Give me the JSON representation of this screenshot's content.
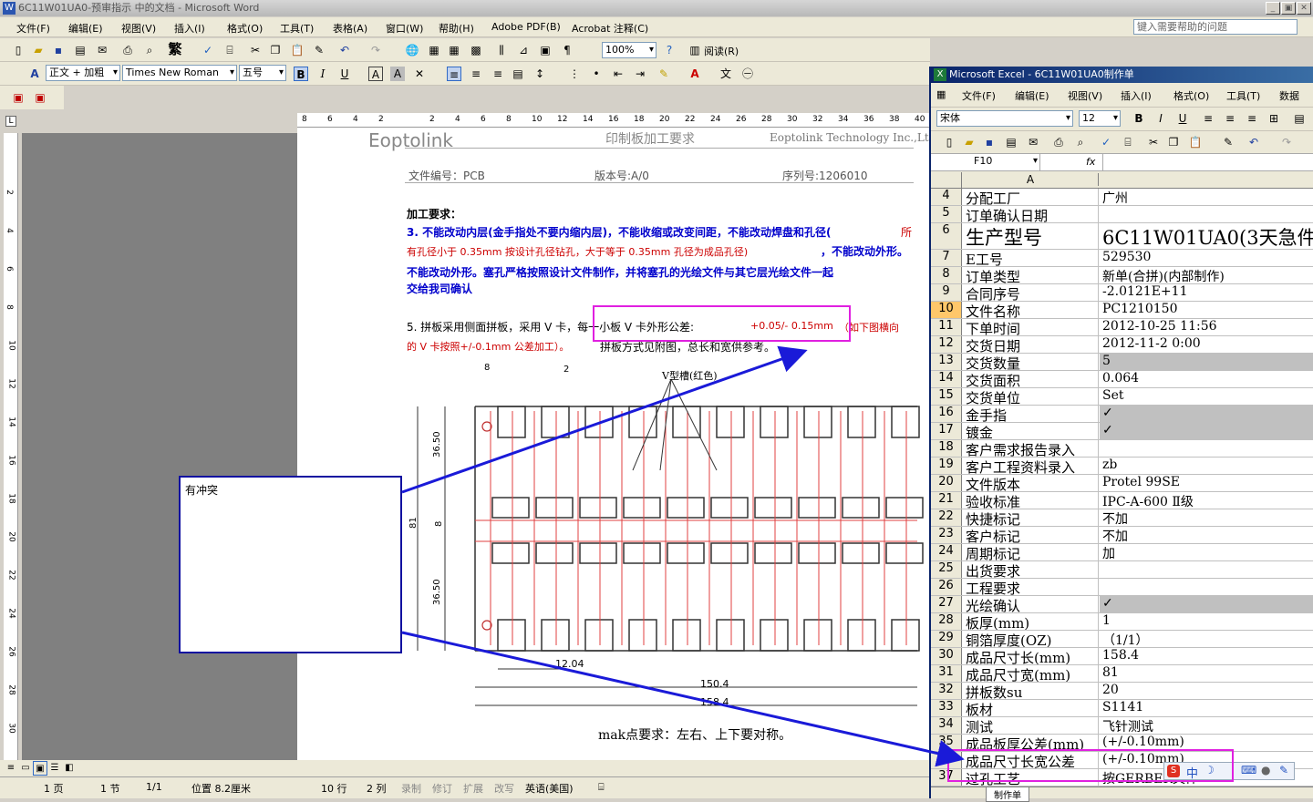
{
  "word": {
    "title": "6C11W01UA0-预审指示 中的文档 - Microsoft Word",
    "menu": [
      "文件(F)",
      "编辑(E)",
      "视图(V)",
      "插入(I)",
      "格式(O)",
      "工具(T)",
      "表格(A)",
      "窗口(W)",
      "帮助(H)",
      "Adobe PDF(B)",
      "Acrobat 注释(C)"
    ],
    "help_placeholder": "键入需要帮助的问题",
    "zoom": "100%",
    "read_label": "阅读(R)",
    "fan_label": "繁",
    "style": "正文 + 加粗",
    "font": "Times New Roman",
    "size": "五号",
    "ruler_ticks": [
      "8",
      "6",
      "4",
      "2",
      "",
      "2",
      "4",
      "6",
      "8",
      "10",
      "12",
      "14",
      "16",
      "18",
      "20",
      "22",
      "24",
      "26",
      "28",
      "30",
      "32",
      "34",
      "36",
      "38",
      "40"
    ],
    "vruler_ticks": [
      "2",
      "4",
      "6",
      "8",
      "10",
      "12",
      "14",
      "16",
      "18",
      "20",
      "22",
      "24",
      "26",
      "28",
      "30"
    ],
    "doc": {
      "logo": "Eoptolink",
      "heading": "印制板加工要求",
      "company": "Eoptolink Technology Inc.,Ltd",
      "file_no": "文件编号：PCB",
      "version": "版本号:A/0",
      "serial": "序列号:1206010",
      "req_title": "加工要求：",
      "req3_line1": "3. 不能改动内层(金手指处不要内缩内层)，不能收缩或改变间距，不能改动焊盘和孔径(",
      "req3_red1": "所",
      "req3_line2_red": "有孔径小于 0.35mm 按设计孔径钻孔，大于等于 0.35mm 孔径为成品孔径)",
      "req3_line2_blue": "，不能改动外形。",
      "req3_line3": "不能改动外形。塞孔严格按照设计文件制作，并将塞孔的光绘文件与其它层光绘文件一起",
      "req3_line4": "交给我司确认",
      "req5_a": "5. 拼板采用侧面拼板，采用 V 卡，每一小板 V 卡外形公差:",
      "req5_tol": "+0.05/- 0.15mm",
      "req5_b": "（如下图横向",
      "req5_c": "的 V 卡按照+/-0.1mm 公差加工）。",
      "req5_d": "拼板方式见附图，总长和宽供参考。",
      "dim_8": "8",
      "dim_2": "2",
      "v_slot": "V型槽(红色)",
      "dim_3650a": "36.50",
      "dim_8b": "8",
      "dim_81": "81",
      "dim_3650b": "36.50",
      "dim_1204": "12.04",
      "dim_1504": "150.4",
      "dim_1584": "158.4",
      "mark_note": "mak点要求：左右、上下要对称。"
    },
    "status": {
      "page": "1 页",
      "section": "1 节",
      "pages": "1/1",
      "pos": "位置 8.2厘米",
      "line": "10 行",
      "col": "2 列",
      "rec": "录制",
      "trk": "修订",
      "ext": "扩展",
      "ovr": "改写",
      "lang": "英语(美国)"
    }
  },
  "excel": {
    "title": "Microsoft Excel - 6C11W01UA0制作单",
    "menu": [
      "文件(F)",
      "编辑(E)",
      "视图(V)",
      "插入(I)",
      "格式(O)",
      "工具(T)",
      "数据"
    ],
    "font": "宋体",
    "size": "12",
    "cell_ref": "F10",
    "fx": "fx",
    "col_a": "A",
    "sheet_tab": "制作单",
    "rows": [
      {
        "n": "4",
        "a": "分配工厂",
        "b": "广州"
      },
      {
        "n": "5",
        "a": "订单确认日期",
        "b": ""
      },
      {
        "n": "6",
        "a": "生产型号",
        "b": "6C11W01UA0(3天急件)"
      },
      {
        "n": "7",
        "a": "E工号",
        "b": "529530"
      },
      {
        "n": "8",
        "a": "订单类型",
        "b": "新单(合拼)(内部制作)"
      },
      {
        "n": "9",
        "a": "合同序号",
        "b": "-2.0121E+11"
      },
      {
        "n": "10",
        "a": "文件名称",
        "b": "PC1210150"
      },
      {
        "n": "11",
        "a": "下单时间",
        "b": "2012-10-25 11:56"
      },
      {
        "n": "12",
        "a": "交货日期",
        "b": "2012-11-2 0:00"
      },
      {
        "n": "13",
        "a": "交货数量",
        "b": "5"
      },
      {
        "n": "14",
        "a": "交货面积",
        "b": "0.064"
      },
      {
        "n": "15",
        "a": "交货单位",
        "b": "Set"
      },
      {
        "n": "16",
        "a": "金手指",
        "b": "✓"
      },
      {
        "n": "17",
        "a": "镀金",
        "b": "✓"
      },
      {
        "n": "18",
        "a": "客户需求报告录入",
        "b": ""
      },
      {
        "n": "19",
        "a": "客户工程资料录入",
        "b": "zb"
      },
      {
        "n": "20",
        "a": "文件版本",
        "b": "Protel 99SE"
      },
      {
        "n": "21",
        "a": "验收标准",
        "b": "IPC-A-600 Ⅱ级"
      },
      {
        "n": "22",
        "a": "快捷标记",
        "b": "不加"
      },
      {
        "n": "23",
        "a": "客户标记",
        "b": "不加"
      },
      {
        "n": "24",
        "a": "周期标记",
        "b": "加"
      },
      {
        "n": "25",
        "a": "出货要求",
        "b": ""
      },
      {
        "n": "26",
        "a": "工程要求",
        "b": ""
      },
      {
        "n": "27",
        "a": "光绘确认",
        "b": "✓"
      },
      {
        "n": "28",
        "a": "板厚(mm)",
        "b": "1"
      },
      {
        "n": "29",
        "a": "铜箔厚度(OZ)",
        "b": "（1/1）"
      },
      {
        "n": "30",
        "a": "成品尺寸长(mm)",
        "b": "158.4"
      },
      {
        "n": "31",
        "a": "成品尺寸宽(mm)",
        "b": "81"
      },
      {
        "n": "32",
        "a": "拼板数su",
        "b": "20"
      },
      {
        "n": "33",
        "a": "板材",
        "b": "S1141"
      },
      {
        "n": "34",
        "a": "测试",
        "b": "飞针测试"
      },
      {
        "n": "35",
        "a": "成品板厚公差(mm)",
        "b": "(+/-0.10mm)"
      },
      {
        "n": "36",
        "a": "成品尺寸长宽公差",
        "b": "(+/-0.10mm)"
      },
      {
        "n": "37",
        "a": "过孔工艺",
        "b": "按GERBER文件"
      }
    ]
  },
  "comment": {
    "text": "有冲突"
  },
  "ime": {
    "label": "中"
  },
  "colors": {
    "annotation": "#1a1ad8",
    "highlight": "#e020e0",
    "pcb_red": "#e04040"
  }
}
